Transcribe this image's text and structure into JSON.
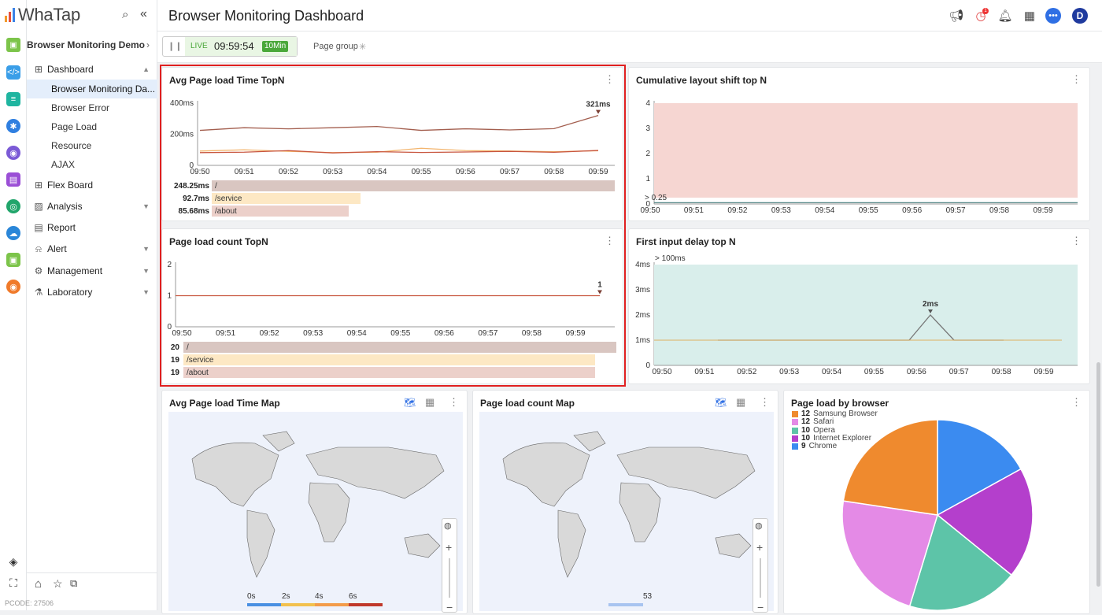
{
  "app": {
    "logo_text": "WhaTap",
    "page_title": "Browser Monitoring Dashboard",
    "pcode": "PCODE: 27506",
    "user_initial": "D",
    "notif_count": "1"
  },
  "sidebar": {
    "project": "Browser Monitoring Demo",
    "items": [
      {
        "label": "Dashboard"
      },
      {
        "label": "Browser Monitoring Da..."
      },
      {
        "label": "Browser Error"
      },
      {
        "label": "Page Load"
      },
      {
        "label": "Resource"
      },
      {
        "label": "AJAX"
      },
      {
        "label": "Flex Board"
      },
      {
        "label": "Analysis"
      },
      {
        "label": "Report"
      },
      {
        "label": "Alert"
      },
      {
        "label": "Management"
      },
      {
        "label": "Laboratory"
      }
    ]
  },
  "live": {
    "label": "LIVE",
    "time": "09:59:54",
    "range": "10Min",
    "page_group": "Page group"
  },
  "times": [
    "09:50",
    "09:51",
    "09:52",
    "09:53",
    "09:54",
    "09:55",
    "09:56",
    "09:57",
    "09:58",
    "09:59"
  ],
  "panels": {
    "avg_load": {
      "title": "Avg Page load Time TopN",
      "y_ticks": [
        "400ms",
        "200ms",
        "0"
      ],
      "peak": "321ms",
      "rows": [
        {
          "value": "248.25ms",
          "label": "/",
          "frac": 1.0,
          "color": "#d9c6c1"
        },
        {
          "value": "92.7ms",
          "label": "/service",
          "frac": 0.37,
          "color": "#fde8c4"
        },
        {
          "value": "85.68ms",
          "label": "/about",
          "frac": 0.34,
          "color": "#ecd0ca"
        }
      ]
    },
    "load_count": {
      "title": "Page load count TopN",
      "y_ticks": [
        "2",
        "1",
        "0"
      ],
      "peak": "1",
      "rows": [
        {
          "value": "20",
          "label": "/",
          "frac": 1.0,
          "color": "#d9c6c1"
        },
        {
          "value": "19",
          "label": "/service",
          "frac": 0.95,
          "color": "#fde8c4"
        },
        {
          "value": "19",
          "label": "/about",
          "frac": 0.95,
          "color": "#ecd0ca"
        }
      ]
    },
    "cls": {
      "title": "Cumulative layout shift top N",
      "y_ticks": [
        "4",
        "3",
        "2",
        "1",
        "0"
      ],
      "threshold": "> 0.25"
    },
    "fid": {
      "title": "First input delay top N",
      "y_ticks": [
        "4ms",
        "3ms",
        "2ms",
        "1ms",
        "0"
      ],
      "threshold": "> 100ms",
      "peak": "2ms"
    },
    "map_time": {
      "title": "Avg Page load Time Map",
      "legend": [
        "0s",
        "2s",
        "4s",
        "6s"
      ]
    },
    "map_count": {
      "title": "Page load count Map",
      "legend_value": "53"
    },
    "browser": {
      "title": "Page load by browser"
    }
  },
  "chart_data": [
    {
      "type": "line",
      "title": "Avg Page load Time TopN",
      "x": [
        "09:50",
        "09:51",
        "09:52",
        "09:53",
        "09:54",
        "09:55",
        "09:56",
        "09:57",
        "09:58",
        "09:59"
      ],
      "ylim": [
        0,
        400
      ],
      "series": [
        {
          "name": "/",
          "values": [
            225,
            242,
            235,
            242,
            250,
            225,
            235,
            228,
            236,
            321
          ]
        },
        {
          "name": "/service",
          "values": [
            92,
            100,
            90,
            82,
            85,
            110,
            95,
            92,
            88,
            94
          ]
        },
        {
          "name": "/about",
          "values": [
            82,
            85,
            95,
            80,
            88,
            83,
            86,
            90,
            84,
            96
          ]
        }
      ]
    },
    {
      "type": "line",
      "title": "Page load count TopN",
      "x": [
        "09:50",
        "09:51",
        "09:52",
        "09:53",
        "09:54",
        "09:55",
        "09:56",
        "09:57",
        "09:58",
        "09:59"
      ],
      "ylim": [
        0,
        2
      ],
      "series": [
        {
          "name": "/",
          "values": [
            1,
            1,
            1,
            1,
            1,
            1,
            1,
            1,
            1,
            1
          ]
        }
      ]
    },
    {
      "type": "line",
      "title": "Cumulative layout shift top N",
      "x": [
        "09:50",
        "09:51",
        "09:52",
        "09:53",
        "09:54",
        "09:55",
        "09:56",
        "09:57",
        "09:58",
        "09:59"
      ],
      "ylim": [
        0,
        4
      ],
      "series": [
        {
          "values": [
            0,
            0,
            0,
            0,
            0,
            0,
            0,
            0,
            0,
            0
          ]
        }
      ]
    },
    {
      "type": "line",
      "title": "First input delay top N",
      "x": [
        "09:50",
        "09:51",
        "09:52",
        "09:53",
        "09:54",
        "09:55",
        "09:56",
        "09:57",
        "09:58",
        "09:59"
      ],
      "ylim": [
        0,
        4
      ],
      "series": [
        {
          "values": [
            1,
            1,
            1,
            1,
            1,
            1,
            2,
            1,
            1,
            1
          ]
        }
      ]
    },
    {
      "type": "pie",
      "title": "Page load by browser",
      "categories": [
        "Samsung Browser",
        "Safari",
        "Opera",
        "Internet Explorer",
        "Chrome"
      ],
      "values": [
        12,
        12,
        10,
        10,
        9
      ],
      "colors": [
        "#ef8a2e",
        "#e48ae6",
        "#5dc4a8",
        "#b43fcc",
        "#3b8bf0"
      ]
    }
  ]
}
